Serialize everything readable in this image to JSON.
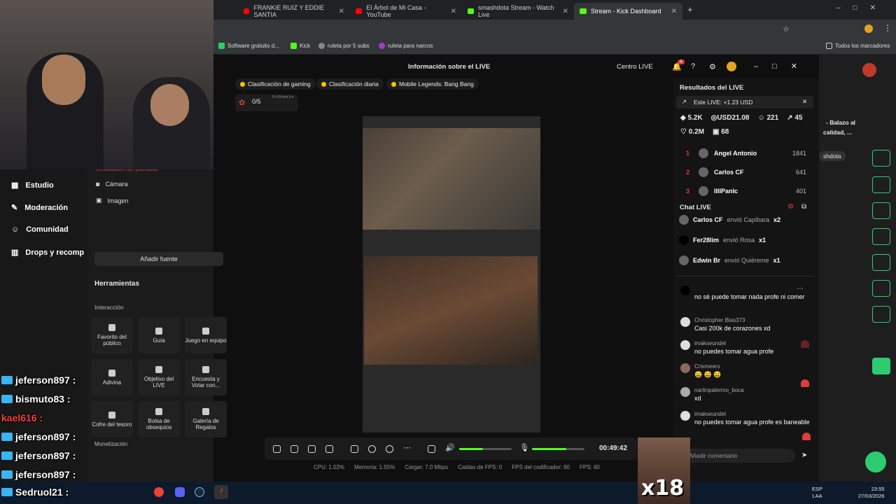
{
  "browser": {
    "tabs": [
      {
        "label": "FRANKIE RUIZ Y EDDIE SANTIA",
        "favicon": "youtube-icon"
      },
      {
        "label": "El Árbol de Mi Casa - YouTube",
        "favicon": "youtube-icon"
      },
      {
        "label": "smashdota Stream - Watch Live",
        "favicon": "kick-icon"
      },
      {
        "label": "Stream - Kick Dashboard",
        "favicon": "kick-icon"
      }
    ],
    "bookmarks": [
      "Software gratuito d...",
      "Kick",
      "ruleta por 5 subs",
      "ruleta para narcos"
    ],
    "all_bookmarks": "Todos los marcadores"
  },
  "left_nav": [
    "Estudio",
    "Moderación",
    "Comunidad",
    "Drops y recomp"
  ],
  "sources": {
    "partial": "Grabación de pantalla",
    "items": [
      "Cámara",
      "Imagen"
    ],
    "add_button": "Añadir fuente"
  },
  "tools": {
    "title": "Herramientas",
    "section": "Interacción",
    "items": [
      "Favorito del público",
      "Guía",
      "Juego en equipo",
      "Adivina",
      "Objetivo del LIVE",
      "Encuesta y Votar con...",
      "Cofre del tesoro",
      "Bolsa de obsequios",
      "Galería de Regalos"
    ],
    "monetization": "Monetización"
  },
  "header": {
    "title": "Información sobre el LIVE",
    "centro": "Centro LIVE",
    "notif_count": "4"
  },
  "pills": [
    "Clasificación de gaming",
    "Clasificación diaria",
    "Mobile Legends: Bang Bang"
  ],
  "goal": {
    "value": "0/5",
    "timer": "3 h 59 min 9 s"
  },
  "results": {
    "title": "Resultados del LIVE",
    "earning": "Este LIVE: +1.23 USD",
    "stats": {
      "diamonds": "5.2K",
      "usd": "USD21.08",
      "viewers": "221",
      "shares": "45",
      "likes": "0.2M",
      "gifts": "68"
    },
    "ranking": [
      {
        "n": "1",
        "name": "Angel Antonio",
        "value": "1841"
      },
      {
        "n": "2",
        "name": "Carlos CF",
        "value": "641"
      },
      {
        "n": "3",
        "name": "IIIIPanIc",
        "value": "401"
      }
    ]
  },
  "chat": {
    "title": "Chat LIVE",
    "gifts": [
      {
        "user": "Carlos CF",
        "text": "envió Capibara",
        "qty": "x2"
      },
      {
        "user": "Fer28lim",
        "text": "envió Rosa",
        "qty": "x1"
      },
      {
        "user": "Edwin Br",
        "text": "envió Quiéreme",
        "qty": "x1"
      }
    ],
    "messages": [
      {
        "user": "",
        "text": "no sé puede tomar nada profe ni comer"
      },
      {
        "user": "Christopher Blas373",
        "text": "Casi 200k de corazones xd"
      },
      {
        "user": "imakseundel",
        "text": "no puedes tomar agua profe"
      },
      {
        "user": "Crismeers",
        "text": "😄 😄 😄"
      },
      {
        "user": "nartinpalermo_boca",
        "text": "xd"
      },
      {
        "user": "imakseundel",
        "text": "no puedes tomar agua profe es baneable"
      }
    ],
    "input_placeholder": "Añadir comentario"
  },
  "controls": {
    "timer": "00:49:42",
    "volume": 0.45,
    "mic": 0.65
  },
  "stats_bar": {
    "cpu": "CPU: 1.02%",
    "mem": "Memoria: 1.55%",
    "load": "Cargar: 7.0 Mbps",
    "fps_drop": "Caídas de FPS: 0",
    "enc": "FPS del codificador: 60",
    "fps": "FPS: 60"
  },
  "right_strip": {
    "text1": "- Balazo al",
    "text2": "calidad, ...",
    "tag": "shdota"
  },
  "overlay_chat": [
    {
      "user": "jeferson897 :",
      "color": "#ffffff"
    },
    {
      "user": "bismuto83 :",
      "color": "#ffffff"
    },
    {
      "user": "kael616 :",
      "color": "#ff3b3b"
    },
    {
      "user": "jeferson897 :",
      "color": "#ffffff"
    },
    {
      "user": "jeferson897 :",
      "color": "#ffffff"
    },
    {
      "user": "jeferson897 :",
      "color": "#ffffff"
    },
    {
      "user": "Sedruol21 :",
      "color": "#ffffff"
    }
  ],
  "overlay_badge": "x18",
  "taskbar": {
    "lang1": "ESP",
    "lang2": "LAA",
    "time": "23:55",
    "date": "27/03/2026"
  }
}
